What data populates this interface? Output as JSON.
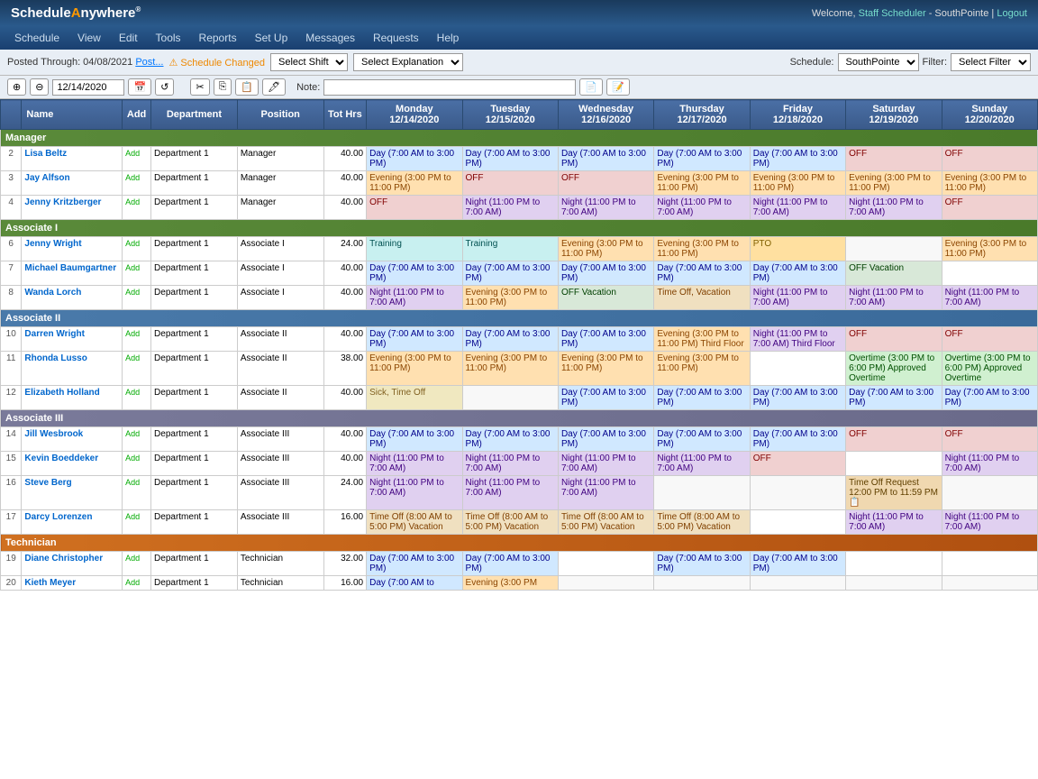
{
  "app": {
    "logo": "ScheduleAnywhere",
    "welcome": "Welcome,",
    "user_link": "Staff Scheduler",
    "org": "SouthPointe",
    "logout": "Logout"
  },
  "nav": {
    "items": [
      "Schedule",
      "View",
      "Edit",
      "Tools",
      "Reports",
      "Set Up",
      "Messages",
      "Requests",
      "Help"
    ]
  },
  "toolbar1": {
    "posted_label": "Posted Through: 04/08/2021",
    "post_link": "Post...",
    "warning": "⚠ Schedule Changed",
    "select_shift_placeholder": "Select Shift",
    "select_explanation_placeholder": "Select Explanation",
    "schedule_label": "Schedule:",
    "schedule_value": "SouthPointe",
    "filter_label": "Filter:",
    "filter_placeholder": "Select Filter"
  },
  "toolbar2": {
    "date_value": "12/14/2020",
    "note_label": "Note:",
    "note_placeholder": ""
  },
  "table": {
    "headers": [
      "",
      "Name",
      "Add",
      "Department",
      "Position",
      "Tot Hrs",
      "Monday\n12/14/2020",
      "Tuesday\n12/15/2020",
      "Wednesday\n12/16/2020",
      "Thursday\n12/17/2020",
      "Friday\n12/18/2020",
      "Saturday\n12/19/2020",
      "Sunday\n12/20/2020"
    ],
    "categories": {
      "1": {
        "label": "Manager",
        "type": "green"
      },
      "5": {
        "label": "Associate I",
        "type": "green"
      },
      "9": {
        "label": "Associate II",
        "type": "blue"
      },
      "13": {
        "label": "Associate III",
        "type": "gray"
      },
      "18": {
        "label": "Technician",
        "type": "orange"
      }
    },
    "rows": [
      {
        "num": 2,
        "name": "Lisa Beltz",
        "dept": "Department 1",
        "pos": "Manager",
        "hrs": "40.00",
        "days": [
          {
            "text": "Day (7:00 AM to 3:00 PM)",
            "type": "day"
          },
          {
            "text": "Day (7:00 AM to 3:00 PM)",
            "type": "day"
          },
          {
            "text": "Day (7:00 AM to 3:00 PM)",
            "type": "day"
          },
          {
            "text": "Day (7:00 AM to 3:00 PM)",
            "type": "day"
          },
          {
            "text": "Day (7:00 AM to 3:00 PM)",
            "type": "day"
          },
          {
            "text": "OFF",
            "type": "off"
          },
          {
            "text": "OFF",
            "type": "off"
          }
        ]
      },
      {
        "num": 3,
        "name": "Jay Alfson",
        "dept": "Department 1",
        "pos": "Manager",
        "hrs": "40.00",
        "days": [
          {
            "text": "Evening (3:00 PM to 11:00 PM)",
            "type": "evening"
          },
          {
            "text": "OFF",
            "type": "off"
          },
          {
            "text": "OFF",
            "type": "off"
          },
          {
            "text": "Evening (3:00 PM to 11:00 PM)",
            "type": "evening"
          },
          {
            "text": "Evening (3:00 PM to 11:00 PM)",
            "type": "evening"
          },
          {
            "text": "Evening (3:00 PM to 11:00 PM)",
            "type": "evening"
          },
          {
            "text": "Evening (3:00 PM to 11:00 PM)",
            "type": "evening"
          }
        ]
      },
      {
        "num": 4,
        "name": "Jenny Kritzberger",
        "dept": "Department 1",
        "pos": "Manager",
        "hrs": "40.00",
        "days": [
          {
            "text": "OFF",
            "type": "off"
          },
          {
            "text": "Night (11:00 PM to 7:00 AM)",
            "type": "night"
          },
          {
            "text": "Night (11:00 PM to 7:00 AM)",
            "type": "night"
          },
          {
            "text": "Night (11:00 PM to 7:00 AM)",
            "type": "night"
          },
          {
            "text": "Night (11:00 PM to 7:00 AM)",
            "type": "night"
          },
          {
            "text": "Night (11:00 PM to 7:00 AM)",
            "type": "night"
          },
          {
            "text": "OFF",
            "type": "off"
          }
        ]
      },
      {
        "num": 6,
        "name": "Jenny Wright",
        "dept": "Department 1",
        "pos": "Associate I",
        "hrs": "24.00",
        "days": [
          {
            "text": "Training",
            "type": "training"
          },
          {
            "text": "Training",
            "type": "training"
          },
          {
            "text": "Evening (3:00 PM to 11:00 PM)",
            "type": "evening"
          },
          {
            "text": "Evening (3:00 PM to 11:00 PM)",
            "type": "evening"
          },
          {
            "text": "PTO",
            "type": "pto"
          },
          {
            "text": "",
            "type": "empty"
          },
          {
            "text": "Evening (3:00 PM to 11:00 PM)",
            "type": "evening"
          }
        ]
      },
      {
        "num": 7,
        "name": "Michael Baumgartner",
        "dept": "Department 1",
        "pos": "Associate I",
        "hrs": "40.00",
        "days": [
          {
            "text": "Day (7:00 AM to 3:00 PM)",
            "type": "day"
          },
          {
            "text": "Day (7:00 AM to 3:00 PM)",
            "type": "day"
          },
          {
            "text": "Day (7:00 AM to 3:00 PM)",
            "type": "day"
          },
          {
            "text": "Day (7:00 AM to 3:00 PM)",
            "type": "day"
          },
          {
            "text": "Day (7:00 AM to 3:00 PM)",
            "type": "day"
          },
          {
            "text": "OFF Vacation",
            "type": "offvac"
          },
          {
            "text": "",
            "type": "empty"
          }
        ]
      },
      {
        "num": 8,
        "name": "Wanda Lorch",
        "dept": "Department 1",
        "pos": "Associate I",
        "hrs": "40.00",
        "days": [
          {
            "text": "Night (11:00 PM to 7:00 AM)",
            "type": "night"
          },
          {
            "text": "Evening (3:00 PM to 11:00 PM)",
            "type": "evening"
          },
          {
            "text": "OFF Vacation",
            "type": "offvac"
          },
          {
            "text": "Time Off, Vacation",
            "type": "timeoff"
          },
          {
            "text": "Night (11:00 PM to 7:00 AM)",
            "type": "night"
          },
          {
            "text": "Night (11:00 PM to 7:00 AM)",
            "type": "night"
          },
          {
            "text": "Night (11:00 PM to 7:00 AM)",
            "type": "night"
          }
        ]
      },
      {
        "num": 10,
        "name": "Darren Wright",
        "dept": "Department 1",
        "pos": "Associate II",
        "hrs": "40.00",
        "days": [
          {
            "text": "Day (7:00 AM to 3:00 PM)",
            "type": "day"
          },
          {
            "text": "Day (7:00 AM to 3:00 PM)",
            "type": "day"
          },
          {
            "text": "Day (7:00 AM to 3:00 PM)",
            "type": "day"
          },
          {
            "text": "Evening (3:00 PM to 11:00 PM) Third Floor",
            "type": "evening"
          },
          {
            "text": "Night (11:00 PM to 7:00 AM) Third Floor",
            "type": "night"
          },
          {
            "text": "OFF",
            "type": "off"
          },
          {
            "text": "OFF",
            "type": "off"
          }
        ]
      },
      {
        "num": 11,
        "name": "Rhonda Lusso",
        "dept": "Department 1",
        "pos": "Associate II",
        "hrs": "38.00",
        "days": [
          {
            "text": "Evening (3:00 PM to 11:00 PM)",
            "type": "evening"
          },
          {
            "text": "Evening (3:00 PM to 11:00 PM)",
            "type": "evening"
          },
          {
            "text": "Evening (3:00 PM to 11:00 PM)",
            "type": "evening"
          },
          {
            "text": "Evening (3:00 PM to 11:00 PM)",
            "type": "evening"
          },
          {
            "text": "",
            "type": "empty"
          },
          {
            "text": "Overtime (3:00 PM to 6:00 PM) Approved Overtime",
            "type": "overtime"
          },
          {
            "text": "Overtime (3:00 PM to 6:00 PM) Approved Overtime",
            "type": "overtime"
          }
        ]
      },
      {
        "num": 12,
        "name": "Elizabeth Holland",
        "dept": "Department 1",
        "pos": "Associate II",
        "hrs": "40.00",
        "days": [
          {
            "text": "Sick, Time Off",
            "type": "sick"
          },
          {
            "text": "",
            "type": "empty"
          },
          {
            "text": "Day (7:00 AM to 3:00 PM)",
            "type": "day"
          },
          {
            "text": "Day (7:00 AM to 3:00 PM)",
            "type": "day"
          },
          {
            "text": "Day (7:00 AM to 3:00 PM)",
            "type": "day"
          },
          {
            "text": "Day (7:00 AM to 3:00 PM)",
            "type": "day"
          },
          {
            "text": "Day (7:00 AM to 3:00 PM)",
            "type": "day"
          }
        ]
      },
      {
        "num": 14,
        "name": "Jill Wesbrook",
        "dept": "Department 1",
        "pos": "Associate III",
        "hrs": "40.00",
        "days": [
          {
            "text": "Day (7:00 AM to 3:00 PM)",
            "type": "day"
          },
          {
            "text": "Day (7:00 AM to 3:00 PM)",
            "type": "day"
          },
          {
            "text": "Day (7:00 AM to 3:00 PM)",
            "type": "day"
          },
          {
            "text": "Day (7:00 AM to 3:00 PM)",
            "type": "day"
          },
          {
            "text": "Day (7:00 AM to 3:00 PM)",
            "type": "day"
          },
          {
            "text": "OFF",
            "type": "off"
          },
          {
            "text": "OFF",
            "type": "off"
          }
        ]
      },
      {
        "num": 15,
        "name": "Kevin Boeddeker",
        "dept": "Department 1",
        "pos": "Associate III",
        "hrs": "40.00",
        "days": [
          {
            "text": "Night (11:00 PM to 7:00 AM)",
            "type": "night"
          },
          {
            "text": "Night (11:00 PM to 7:00 AM)",
            "type": "night"
          },
          {
            "text": "Night (11:00 PM to 7:00 AM)",
            "type": "night"
          },
          {
            "text": "Night (11:00 PM to 7:00 AM)",
            "type": "night"
          },
          {
            "text": "OFF",
            "type": "off"
          },
          {
            "text": "",
            "type": "empty"
          },
          {
            "text": "Night (11:00 PM to 7:00 AM)",
            "type": "night"
          }
        ]
      },
      {
        "num": 16,
        "name": "Steve Berg",
        "dept": "Department 1",
        "pos": "Associate III",
        "hrs": "24.00",
        "days": [
          {
            "text": "Night (11:00 PM to 7:00 AM)",
            "type": "night"
          },
          {
            "text": "Night (11:00 PM to 7:00 AM)",
            "type": "night"
          },
          {
            "text": "Night (11:00 PM to 7:00 AM)",
            "type": "night"
          },
          {
            "text": "",
            "type": "empty"
          },
          {
            "text": "",
            "type": "empty"
          },
          {
            "text": "Time Off Request 12:00 PM to 11:59 PM 📋",
            "type": "timereq"
          },
          {
            "text": "",
            "type": "empty"
          }
        ]
      },
      {
        "num": 17,
        "name": "Darcy Lorenzen",
        "dept": "Department 1",
        "pos": "Associate III",
        "hrs": "16.00",
        "days": [
          {
            "text": "Time Off (8:00 AM to 5:00 PM) Vacation",
            "type": "timeoff"
          },
          {
            "text": "Time Off (8:00 AM to 5:00 PM) Vacation",
            "type": "timeoff"
          },
          {
            "text": "Time Off (8:00 AM to 5:00 PM) Vacation",
            "type": "timeoff"
          },
          {
            "text": "Time Off (8:00 AM to 5:00 PM) Vacation",
            "type": "timeoff"
          },
          {
            "text": "",
            "type": "empty"
          },
          {
            "text": "Night (11:00 PM to 7:00 AM)",
            "type": "night"
          },
          {
            "text": "Night (11:00 PM to 7:00 AM)",
            "type": "night"
          }
        ]
      },
      {
        "num": 19,
        "name": "Diane Christopher",
        "dept": "Department 1",
        "pos": "Technician",
        "hrs": "32.00",
        "days": [
          {
            "text": "Day (7:00 AM to 3:00 PM)",
            "type": "day"
          },
          {
            "text": "Day (7:00 AM to 3:00 PM)",
            "type": "day"
          },
          {
            "text": "",
            "type": "empty"
          },
          {
            "text": "Day (7:00 AM to 3:00 PM)",
            "type": "day"
          },
          {
            "text": "Day (7:00 AM to 3:00 PM)",
            "type": "day"
          },
          {
            "text": "",
            "type": "empty"
          },
          {
            "text": "",
            "type": "empty"
          }
        ]
      },
      {
        "num": 20,
        "name": "Kieth Meyer",
        "dept": "Department 1",
        "pos": "Technician",
        "hrs": "16.00",
        "days": [
          {
            "text": "Day (7:00 AM to",
            "type": "day"
          },
          {
            "text": "Evening (3:00 PM",
            "type": "evening"
          },
          {
            "text": "",
            "type": "empty"
          },
          {
            "text": "",
            "type": "empty"
          },
          {
            "text": "",
            "type": "empty"
          },
          {
            "text": "",
            "type": "empty"
          },
          {
            "text": "",
            "type": "empty"
          }
        ]
      }
    ]
  }
}
